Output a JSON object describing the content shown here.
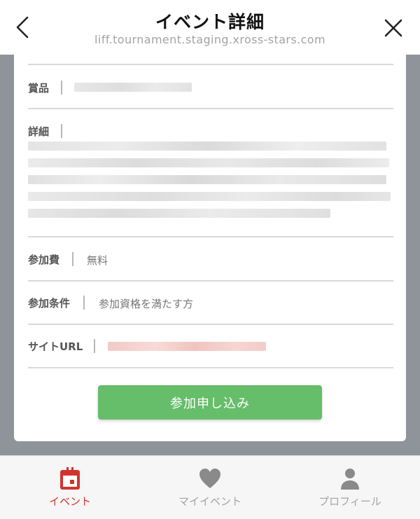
{
  "header": {
    "title": "イベント詳細",
    "url": "liff.tournament.staging.xross-stars.com",
    "back_icon": "chevron-left-icon",
    "close_icon": "close-icon"
  },
  "details": {
    "prize_label": "賞品",
    "detail_label": "詳細",
    "fee_label": "参加費",
    "fee_value": "無料",
    "condition_label": "参加条件",
    "condition_value": "参加資格を満たす方",
    "site_url_label": "サイトURL"
  },
  "submit_button": {
    "label": "参加申し込み",
    "color": "#66bd6a"
  },
  "tabbar": {
    "active_color": "#d2332e",
    "inactive_color": "#a3a3a3",
    "tabs": [
      {
        "label": "イベント",
        "icon": "calendar-icon",
        "active": true
      },
      {
        "label": "マイイベント",
        "icon": "heart-icon",
        "active": false
      },
      {
        "label": "プロフィール",
        "icon": "person-icon",
        "active": false
      }
    ]
  }
}
